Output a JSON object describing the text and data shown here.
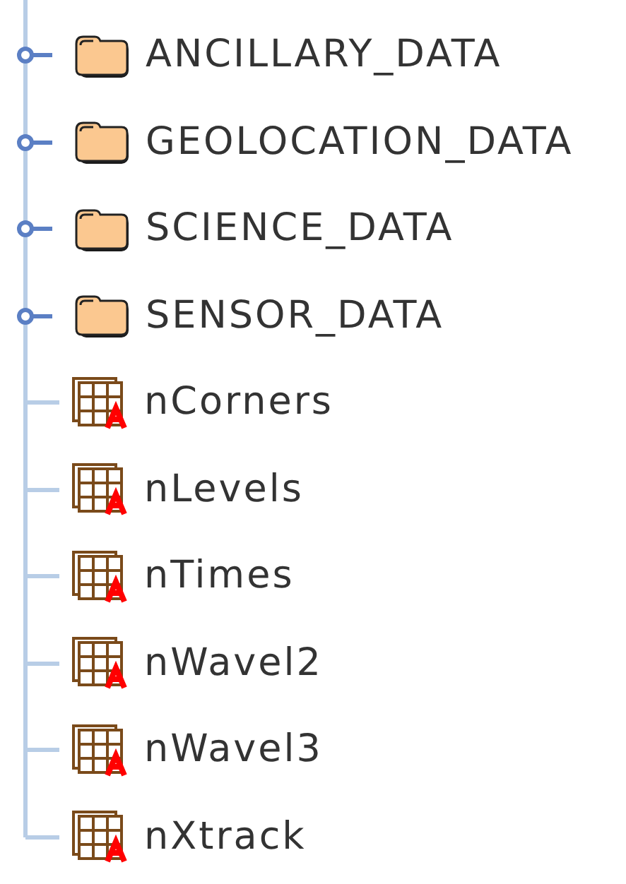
{
  "tree": {
    "items": [
      {
        "kind": "group",
        "label": "ANCILLARY_DATA",
        "expanded": false
      },
      {
        "kind": "group",
        "label": "GEOLOCATION_DATA",
        "expanded": false
      },
      {
        "kind": "group",
        "label": "SCIENCE_DATA",
        "expanded": false
      },
      {
        "kind": "group",
        "label": "SENSOR_DATA",
        "expanded": false
      },
      {
        "kind": "dataset",
        "label": "nCorners"
      },
      {
        "kind": "dataset",
        "label": "nLevels"
      },
      {
        "kind": "dataset",
        "label": "nTimes"
      },
      {
        "kind": "dataset",
        "label": "nWavel2"
      },
      {
        "kind": "dataset",
        "label": "nWavel3"
      },
      {
        "kind": "dataset",
        "label": "nXtrack"
      }
    ]
  }
}
